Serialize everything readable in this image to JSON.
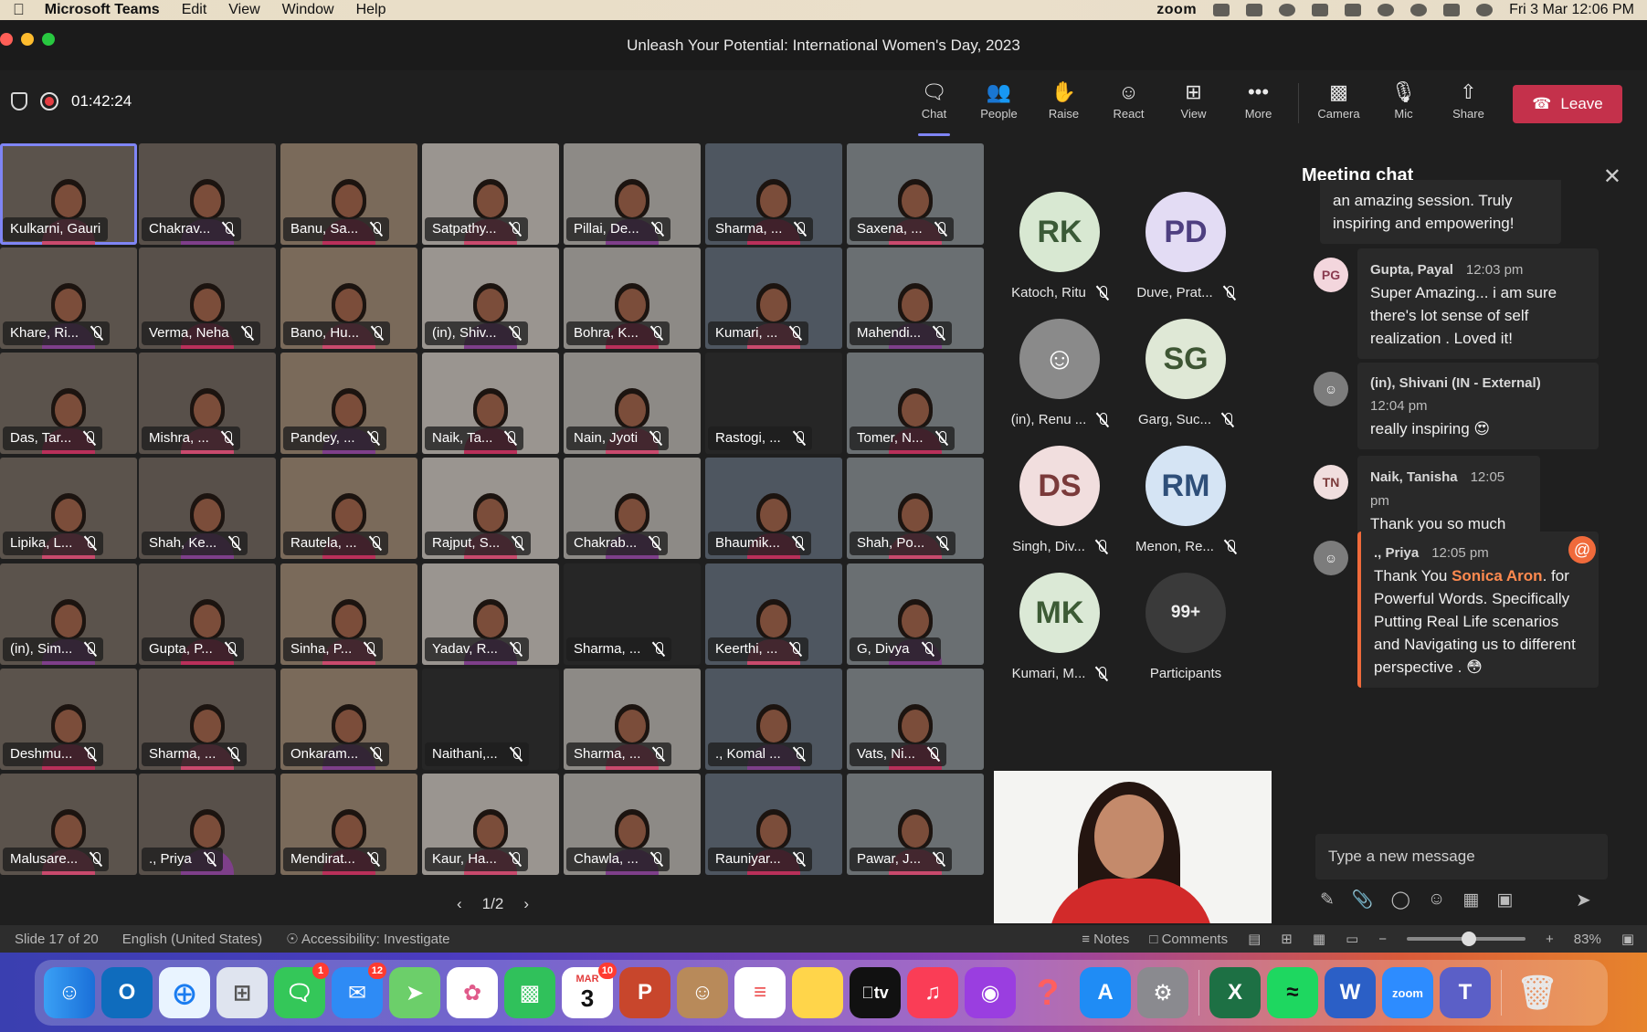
{
  "menubar": {
    "app": "Microsoft Teams",
    "menus": [
      "Edit",
      "View",
      "Window",
      "Help"
    ],
    "zoom": "zoom",
    "datetime": "Fri 3 Mar  12:06 PM"
  },
  "window": {
    "title": "Unleash Your Potential: International Women's Day, 2023"
  },
  "toolbar": {
    "timer": "01:42:24",
    "buttons": [
      {
        "label": "Chat",
        "icon": "chat-icon"
      },
      {
        "label": "People",
        "icon": "people-icon"
      },
      {
        "label": "Raise",
        "icon": "raise-hand-icon"
      },
      {
        "label": "React",
        "icon": "smiley-icon"
      },
      {
        "label": "View",
        "icon": "grid-icon"
      },
      {
        "label": "More",
        "icon": "more-icon"
      },
      {
        "label": "Camera",
        "icon": "camera-icon"
      },
      {
        "label": "Mic",
        "icon": "mic-icon"
      },
      {
        "label": "Share",
        "icon": "share-icon"
      }
    ],
    "leave": "Leave"
  },
  "grid": {
    "tiles": [
      "Kulkarni, Gauri",
      "Chakrav...",
      "Banu, Sa...",
      "Satpathy...",
      "Pillai, De...",
      "Sharma, ...",
      "Saxena, ...",
      "Khare, Ri...",
      "Verma, Neha",
      "Bano, Hu...",
      "(in), Shiv...",
      "Bohra, K...",
      "Kumari, ...",
      "Mahendi...",
      "Das, Tar...",
      "Mishra, ...",
      "Pandey, ...",
      "Naik, Ta...",
      "Nain, Jyoti",
      "Rastogi, ...",
      "Tomer, N...",
      "Lipika, L...",
      "Shah, Ke...",
      "Rautela, ...",
      "Rajput, S...",
      "Chakrab...",
      "Bhaumik...",
      "Shah, Po...",
      "(in), Sim...",
      "Gupta, P...",
      "Sinha, P...",
      "Yadav, R...",
      "Sharma, ...",
      "Keerthi, ...",
      "G, Divya",
      "Deshmu...",
      "Sharma, ...",
      "Onkaram...",
      "Naithani,...",
      "Sharma, ...",
      "., Komal ...",
      "Vats, Ni...",
      "Malusare...",
      "., Priya",
      "Mendirat...",
      "Kaur, Ha...",
      "Chawla, ...",
      "Rauniyar...",
      "Pawar, J..."
    ],
    "page": "1/2"
  },
  "avatars": [
    {
      "initials": "RK",
      "name": "Katoch, Ritu",
      "bg": "#d8e8d2",
      "fg": "#3b5a37"
    },
    {
      "initials": "PD",
      "name": "Duve, Prat...",
      "bg": "#e3dcf4",
      "fg": "#4e3f80"
    },
    {
      "initials": "",
      "name": "(in), Renu ...",
      "bg": "#8a8a8a",
      "fg": "#fff"
    },
    {
      "initials": "SG",
      "name": "Garg, Suc...",
      "bg": "#dfe8d6",
      "fg": "#3e5634"
    },
    {
      "initials": "DS",
      "name": "Singh, Div...",
      "bg": "#f1dede",
      "fg": "#7a3a3a"
    },
    {
      "initials": "RM",
      "name": "Menon, Re...",
      "bg": "#d5e4f4",
      "fg": "#2f4f79"
    },
    {
      "initials": "MK",
      "name": "Kumari, M...",
      "bg": "#dbe9d6",
      "fg": "#3c5b35"
    },
    {
      "initials": "99+",
      "name": "Participants",
      "bg": "#3a3a3a",
      "fg": "#eee"
    }
  ],
  "chat": {
    "title": "Meeting chat",
    "messages": [
      {
        "text": "an amazing session. Truly inspiring and empowering!"
      },
      {
        "initials": "PG",
        "author": "Gupta, Payal",
        "time": "12:03 pm",
        "text": "Super Amazing... i am sure there's lot  sense of self realization . Loved it!"
      },
      {
        "author": "(in), Shivani (IN - External)",
        "time": "12:04 pm",
        "text": "really inspiring 😍"
      },
      {
        "initials": "TN",
        "author": "Naik, Tanisha",
        "time": "12:05 pm",
        "text": "Thank you so much"
      },
      {
        "author": "., Priya",
        "time": "12:05 pm",
        "text_before": "Thank You ",
        "mention": "Sonica Aron",
        "text_after": ". for Powerful Words. Specifically Putting Real Life scenarios and Navigating us to  different perspective . 😳"
      }
    ],
    "compose_placeholder": "Type a new message"
  },
  "statusbar": {
    "slide": "Slide 17 of 20",
    "language": "English (United States)",
    "accessibility": "Accessibility: Investigate",
    "notes": "Notes",
    "comments": "Comments",
    "zoom": "83%"
  },
  "dock": {
    "badges": {
      "messages": "1",
      "mail": "12",
      "calendar": "10"
    },
    "calendar_month": "MAR",
    "calendar_day": "3"
  }
}
